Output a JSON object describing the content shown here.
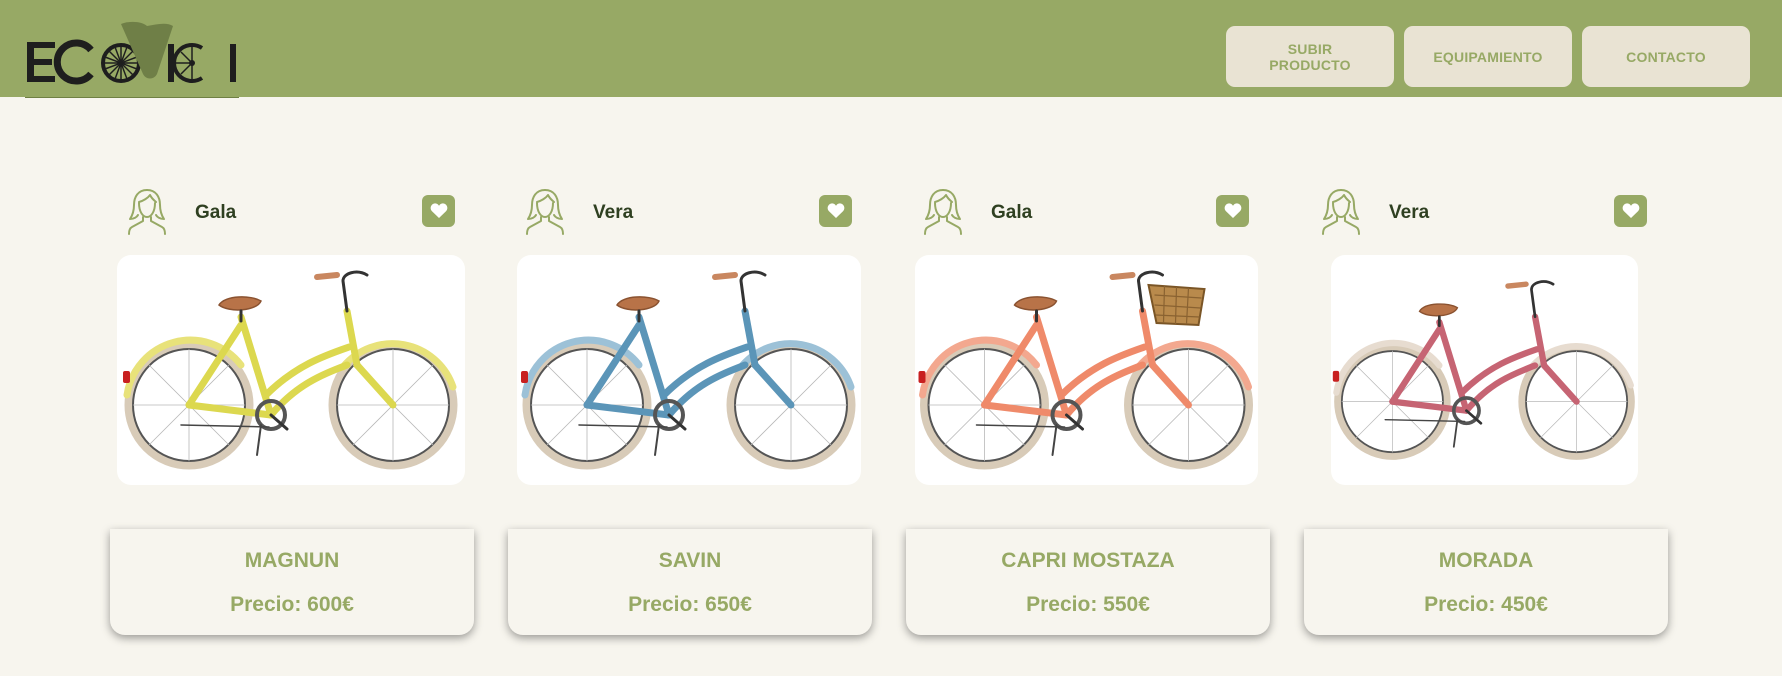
{
  "brand": {
    "logo_text": "ECOVICI"
  },
  "nav": {
    "items": [
      {
        "label": "SUBIR PRODUCTO",
        "line1": "SUBIR",
        "line2": "PRODUCTO"
      },
      {
        "label": "EQUIPAMIENTO"
      },
      {
        "label": "CONTACTO"
      }
    ]
  },
  "products": [
    {
      "seller": "Gala",
      "name": "MAGNUN",
      "price": "Precio: 600€",
      "frame_color": "#dcd84f",
      "fender_color": "#e8e27a",
      "has_basket": false
    },
    {
      "seller": "Vera",
      "name": "SAVIN",
      "price": "Precio: 650€",
      "frame_color": "#5b95b8",
      "fender_color": "#9cc1d7",
      "has_basket": false
    },
    {
      "seller": "Gala",
      "name": "CAPRI MOSTAZA",
      "price": "Precio: 550€",
      "frame_color": "#ef8a6a",
      "fender_color": "#f3a88f",
      "has_basket": true
    },
    {
      "seller": "Vera",
      "name": "MORADA",
      "price": "Precio: 450€",
      "frame_color": "#c66473",
      "fender_color": "#e7dcd0",
      "has_basket": false
    }
  ],
  "icons": {
    "avatar": "user-outline-icon",
    "favorite": "heart-icon",
    "logo": "ecovici-logo"
  },
  "colors": {
    "header_bg": "#97a965",
    "page_bg": "#f7f5ee",
    "button_bg": "#e9e3d3",
    "accent": "#97a965",
    "seller_text": "#2f4021"
  }
}
